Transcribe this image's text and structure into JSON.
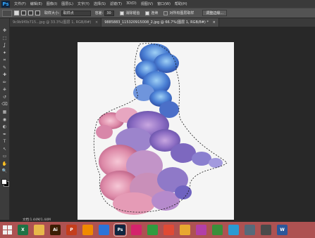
{
  "app": {
    "logo": "Ps"
  },
  "menu": [
    "文件(F)",
    "编辑(E)",
    "图像(I)",
    "图层(L)",
    "文字(Y)",
    "选择(S)",
    "滤镜(T)",
    "3D(D)",
    "视图(V)",
    "窗口(W)",
    "帮助(H)"
  ],
  "options": {
    "size_label": "取样大小:",
    "size_value": "取样点",
    "tolerance_label": "容差:",
    "tolerance_value": "30",
    "antialias_label": "消除锯齿",
    "contiguous_label": "连续",
    "all_layers_label": "对所有图层取样",
    "refine_button": "调整边缘..."
  },
  "tabs": [
    {
      "label": "9c9b9f0b715...jpg @ 33.3%(图层 1, RGB/8#)",
      "active": false
    },
    {
      "label": "9885883_115320915008_2.jpg @ 66.7%(图层 1, RGB/8#) *",
      "active": true
    }
  ],
  "toolbar": [
    "move-tool",
    "marquee-tool",
    "lasso-tool",
    "magic-wand-tool",
    "crop-tool",
    "eyedropper-tool",
    "healing-tool",
    "brush-tool",
    "clone-stamp-tool",
    "history-brush-tool",
    "eraser-tool",
    "gradient-tool",
    "blur-tool",
    "dodge-tool",
    "pen-tool",
    "type-tool",
    "path-select-tool",
    "shape-tool",
    "hand-tool",
    "zoom-tool"
  ],
  "status": {
    "doc": "文档:1.44M/1.44M"
  },
  "taskbar": [
    {
      "name": "excel",
      "label": "X",
      "color": "#1f7244"
    },
    {
      "name": "file-explorer",
      "label": "",
      "color": "#e8b84a"
    },
    {
      "name": "illustrator",
      "label": "Ai",
      "color": "#3b1d03"
    },
    {
      "name": "powerpoint",
      "label": "P",
      "color": "#c43e1c"
    },
    {
      "name": "media",
      "label": "",
      "color": "#f08a00"
    },
    {
      "name": "baidu-netdisk",
      "label": "",
      "color": "#2b74d9"
    },
    {
      "name": "photoshop",
      "label": "Ps",
      "color": "#10253f",
      "active": true
    },
    {
      "name": "player",
      "label": "",
      "color": "#d4236c"
    },
    {
      "name": "browser",
      "label": "",
      "color": "#2f9c3f"
    },
    {
      "name": "video",
      "label": "",
      "color": "#e04a35"
    },
    {
      "name": "folder",
      "label": "",
      "color": "#e8a830"
    },
    {
      "name": "media-app",
      "label": "",
      "color": "#b23fa8"
    },
    {
      "name": "chrome",
      "label": "",
      "color": "#3a8f3a"
    },
    {
      "name": "network",
      "label": "",
      "color": "#2a9bd4"
    },
    {
      "name": "monitor",
      "label": "",
      "color": "#566a7a"
    },
    {
      "name": "keyboard",
      "label": "",
      "color": "#4a4a4a"
    },
    {
      "name": "word",
      "label": "W",
      "color": "#2b579a"
    }
  ],
  "colors": {
    "menubar": "#3a3a3a",
    "optionsbar": "#535353",
    "canvas": "#282828",
    "taskbar": "#ad5252"
  }
}
